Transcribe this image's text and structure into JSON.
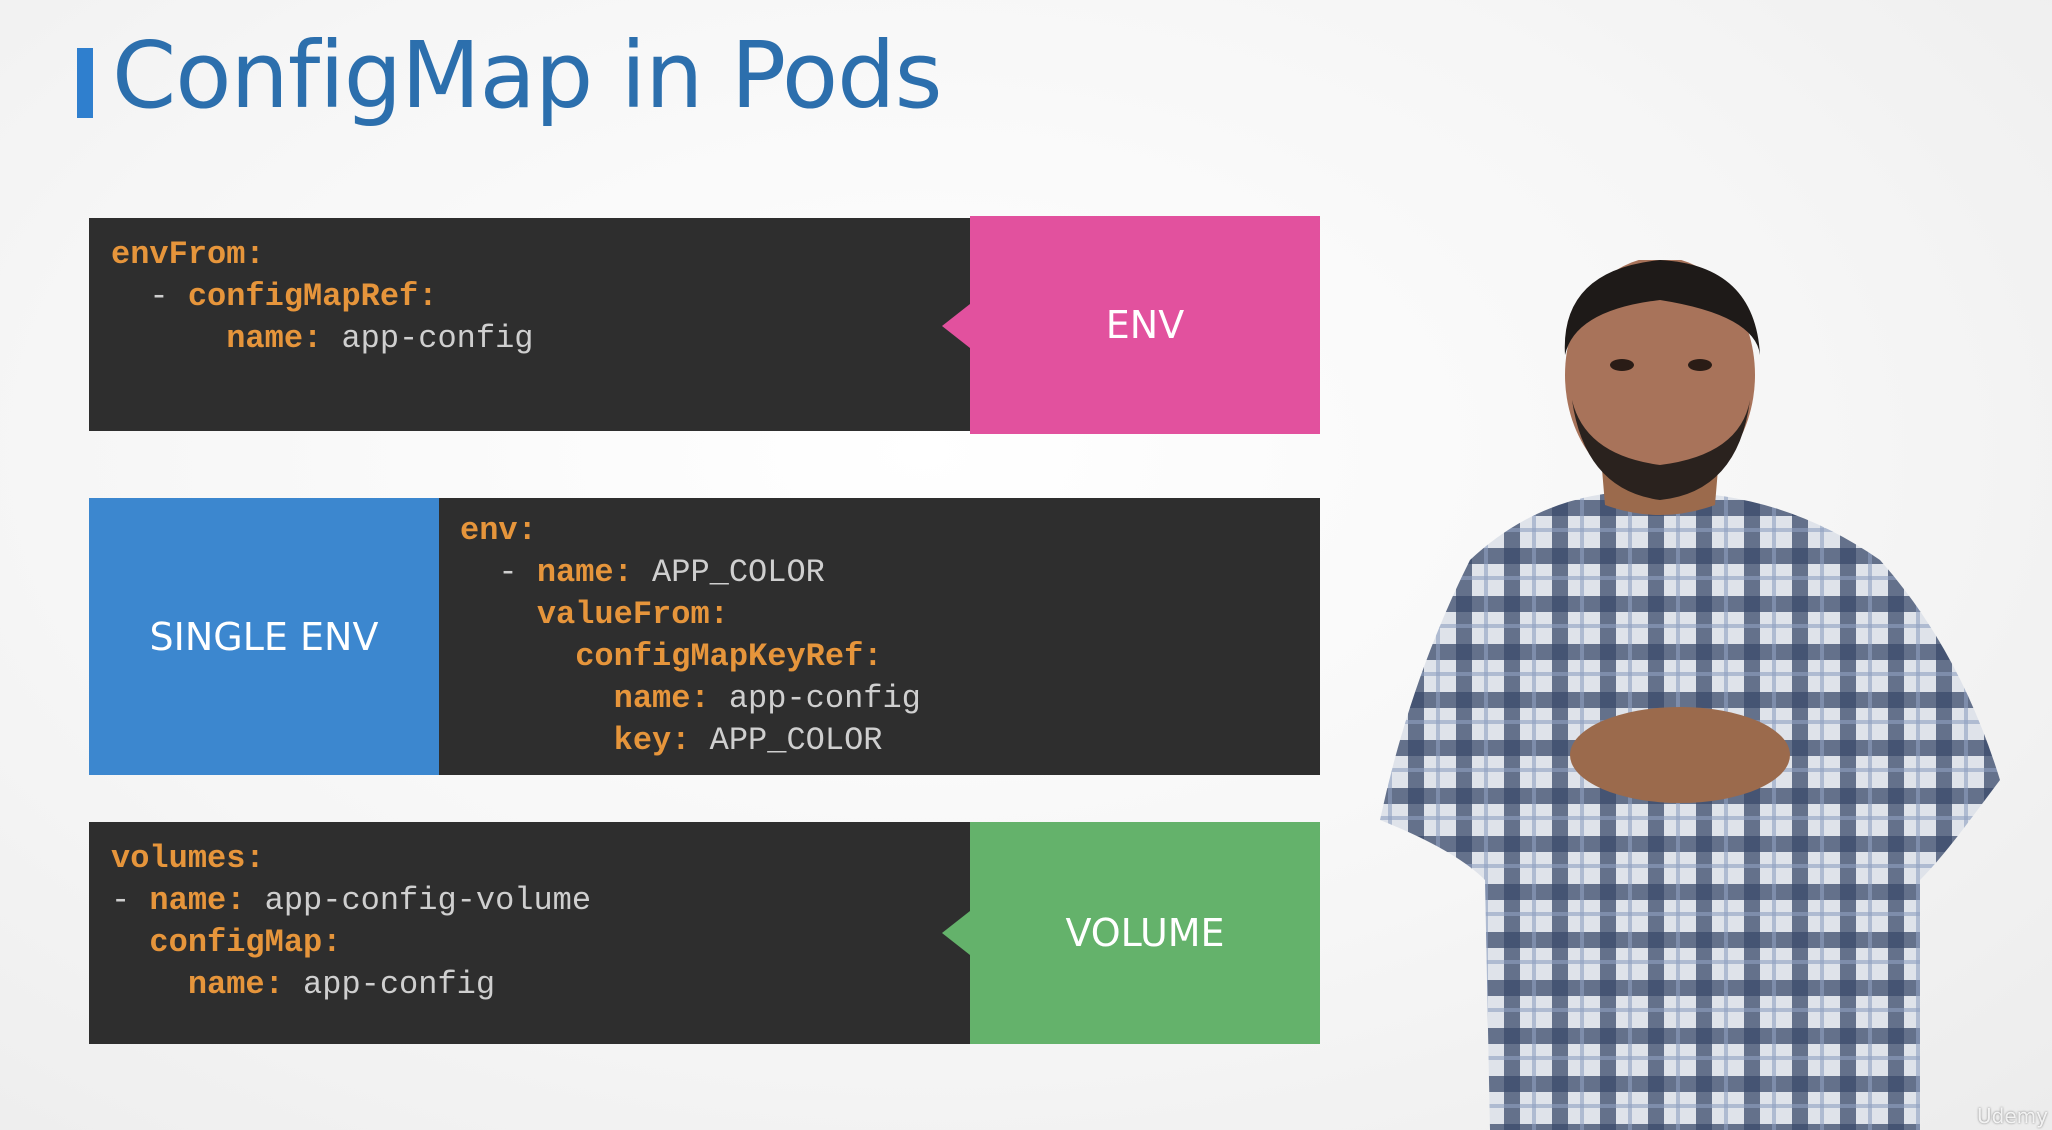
{
  "slide": {
    "title": "ConfigMap in Pods",
    "watermark": "Udemy"
  },
  "rows": {
    "env": {
      "label": "ENV",
      "color": "#e2519e",
      "code": {
        "l1_key": "envFrom:",
        "l2_dash": "  - ",
        "l2_key": "configMapRef:",
        "l3_indent": "      ",
        "l3_key": "name:",
        "l3_val": " app-config"
      }
    },
    "single_env": {
      "label": "SINGLE ENV",
      "color": "#3c87cf",
      "code": {
        "l1_key": "env:",
        "l2_dash": "  - ",
        "l2_key": "name:",
        "l2_val": " APP_COLOR",
        "l3_indent": "    ",
        "l3_key": "valueFrom:",
        "l4_indent": "      ",
        "l4_key": "configMapKeyRef:",
        "l5_indent": "        ",
        "l5_key": "name:",
        "l5_val": " app-config",
        "l6_indent": "        ",
        "l6_key": "key:",
        "l6_val": " APP_COLOR"
      }
    },
    "volume": {
      "label": "VOLUME",
      "color": "#64b26b",
      "code": {
        "l1_key": "volumes:",
        "l2_dash": "- ",
        "l2_key": "name:",
        "l2_val": " app-config-volume",
        "l3_indent": "  ",
        "l3_key": "configMap:",
        "l4_indent": "    ",
        "l4_key": "name:",
        "l4_val": " app-config"
      }
    }
  },
  "colors": {
    "title": "#2c6fad",
    "code_bg": "#2e2e2e",
    "code_key": "#e6953b",
    "code_value": "#cfcfcf"
  }
}
